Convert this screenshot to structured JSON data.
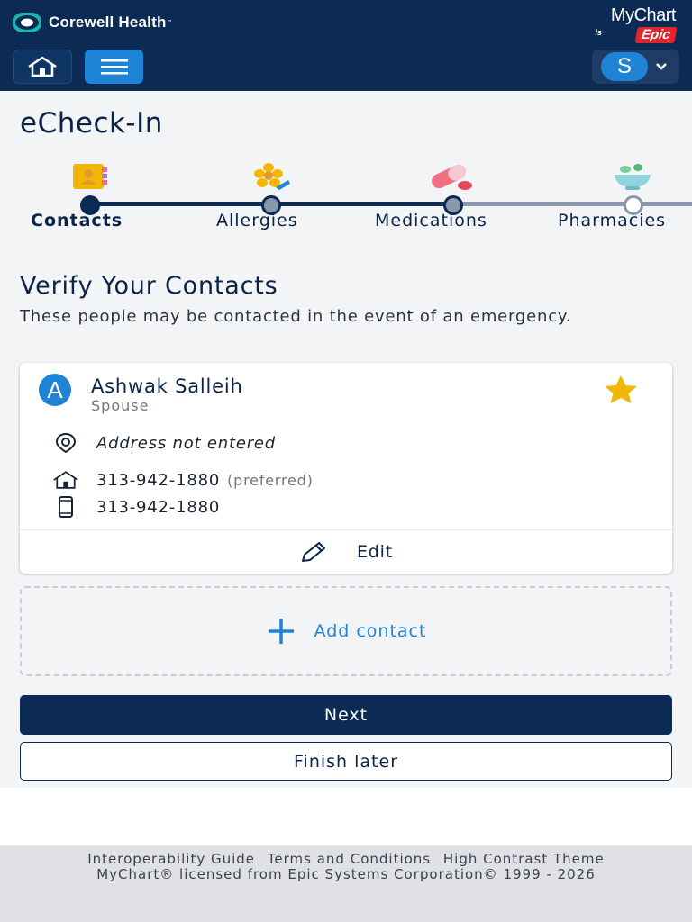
{
  "header": {
    "brand": "Corewell Health",
    "brand_tm": "™",
    "mychart_name": "MyChart",
    "mychart_is": "is",
    "mychart_epic": "Epic",
    "account_initial": "S"
  },
  "page": {
    "title": "eCheck-In"
  },
  "steps": [
    {
      "label": "Contacts",
      "icon": "contacts-book-icon",
      "state": "current"
    },
    {
      "label": "Allergies",
      "icon": "flower-allergy-icon",
      "state": "upcoming"
    },
    {
      "label": "Medications",
      "icon": "pill-icon",
      "state": "upcoming"
    },
    {
      "label": "Pharmacies",
      "icon": "mortar-pestle-icon",
      "state": "upcoming"
    }
  ],
  "section": {
    "title": "Verify Your Contacts",
    "description": "These people may be contacted in the event of an emergency."
  },
  "contact": {
    "initial": "A",
    "name": "Ashwak Salleih",
    "relationship": "Spouse",
    "address": "Address not entered",
    "home_phone": "313-942-1880",
    "home_phone_note": "(preferred)",
    "mobile_phone": "313-942-1880",
    "edit_label": "Edit"
  },
  "add_contact_label": "Add contact",
  "buttons": {
    "next": "Next",
    "finish_later": "Finish later"
  },
  "footer": {
    "link_interop": "Interoperability Guide",
    "link_terms": "Terms and Conditions",
    "link_contrast": "High Contrast Theme",
    "copyright": "MyChart® licensed from Epic Systems Corporation© 1999 - 2026"
  },
  "colors": {
    "header_bg": "#0b2a54",
    "accent_blue": "#1f84d6",
    "star_gold": "#f2b705",
    "epic_red": "#e0252d"
  }
}
